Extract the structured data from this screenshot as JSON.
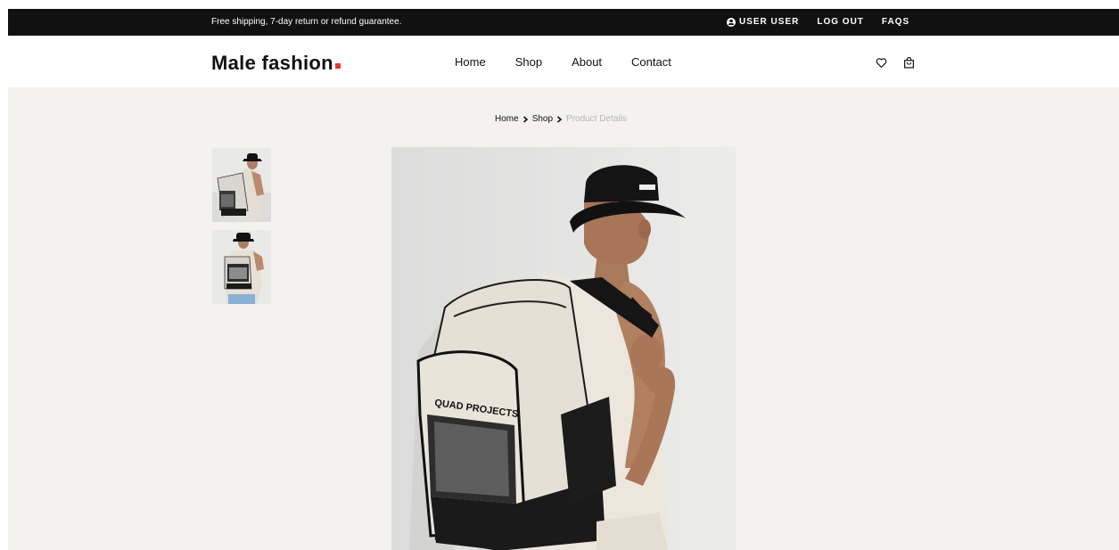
{
  "topbar": {
    "promo": "Free shipping, 7-day return or refund guarantee.",
    "user": "USER USER",
    "logout": "LOG OUT",
    "faqs": "FAQS"
  },
  "header": {
    "logo": "Male fashion",
    "nav": [
      "Home",
      "Shop",
      "About",
      "Contact"
    ]
  },
  "breadcrumb": [
    "Home",
    "Shop",
    "Product Details"
  ],
  "product": {
    "bag_print": "QUAD PROJECTS",
    "hat_print": "NO|ANC"
  },
  "colors": {
    "accent": "#e53637",
    "topbar_bg": "#111111",
    "page_bg": "#f3f2ee"
  },
  "icons": [
    "user-icon",
    "heart-icon",
    "shopping-bag-icon",
    "chevron-right-icon"
  ]
}
